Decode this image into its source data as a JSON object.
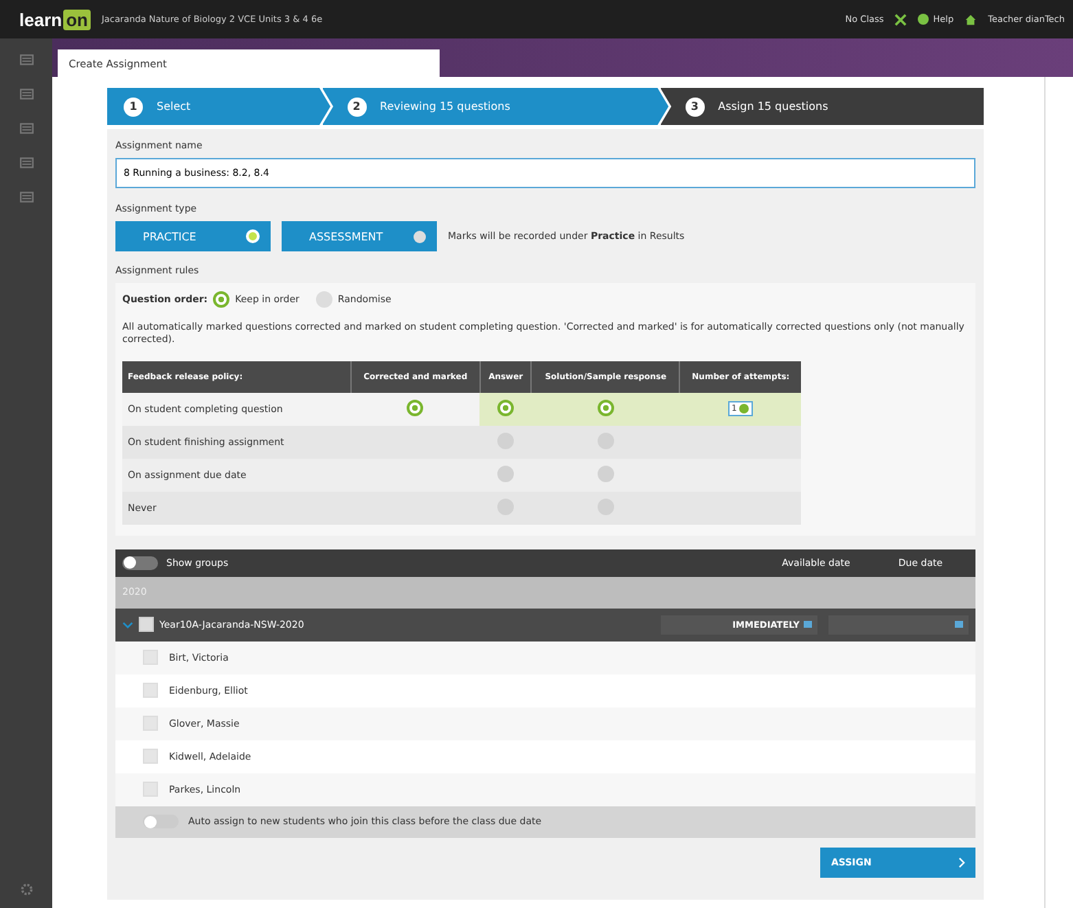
{
  "topbar": {
    "logo_a": "learn",
    "logo_b": "on",
    "title": "Jacaranda Nature of Biology 2 VCE Units 3 & 4 6e",
    "no_class": "No Class",
    "help": "Help",
    "user": "Teacher dianTech"
  },
  "tab": "Create Assignment",
  "steps": [
    {
      "number": "1",
      "label": "Select",
      "done": true
    },
    {
      "number": "2",
      "label": "Reviewing 15 questions",
      "done": true
    },
    {
      "number": "3",
      "label": "Assign 15 questions",
      "done": false
    }
  ],
  "name_label": "Assignment name",
  "name_value": "8 Running a business: 8.2, 8.4",
  "type_label": "Assignment type",
  "types": [
    {
      "label": "PRACTICE",
      "selected": true
    },
    {
      "label": "ASSESSMENT",
      "selected": false
    }
  ],
  "type_note": "Marks will be recorded under **Practice** in Results",
  "rules_label": "Assignment rules",
  "order_label": "Question order:",
  "order_options": [
    {
      "label": "Keep in order",
      "selected": true
    },
    {
      "label": "Randomise",
      "selected": false
    }
  ],
  "rules_note": "All automatically marked questions corrected and marked on student completing question. 'Corrected and marked' is for automatically corrected questions only (not manually corrected).",
  "table": {
    "columns": [
      "Feedback release policy:",
      "Corrected and marked",
      "Answer",
      "Solution/Sample response",
      "Number of attempts:"
    ],
    "rows": [
      {
        "label": "On student completing question",
        "selected": true,
        "corrected": true,
        "answer": true,
        "solution": true,
        "attempts": "1"
      },
      {
        "label": "On student finishing assignment",
        "selected": false,
        "answer": false,
        "solution": false
      },
      {
        "label": "On assignment due date",
        "selected": false,
        "answer": false,
        "solution": false
      },
      {
        "label": "Never",
        "selected": false,
        "answer": false,
        "solution": false
      }
    ]
  },
  "groups": {
    "show_groups_label": "Show groups",
    "show_groups_on": false,
    "available_col": "Available date",
    "due_col": "Due date",
    "year": "2020",
    "class": {
      "name": "Year10A-Jacaranda-NSW-2020",
      "expanded": true,
      "checked": false,
      "available": "IMMEDIATELY"
    },
    "students": [
      {
        "name": "Birt, Victoria",
        "checked": false
      },
      {
        "name": "Eidenburg, Elliot",
        "checked": false
      },
      {
        "name": "Glover, Massie",
        "checked": false
      },
      {
        "name": "Kidwell, Adelaide",
        "checked": false
      },
      {
        "name": "Parkes, Lincoln",
        "checked": false
      }
    ],
    "auto_label": "Auto assign to new students who join this class before the class due date",
    "auto_on": false
  },
  "assign_button": "ASSIGN"
}
